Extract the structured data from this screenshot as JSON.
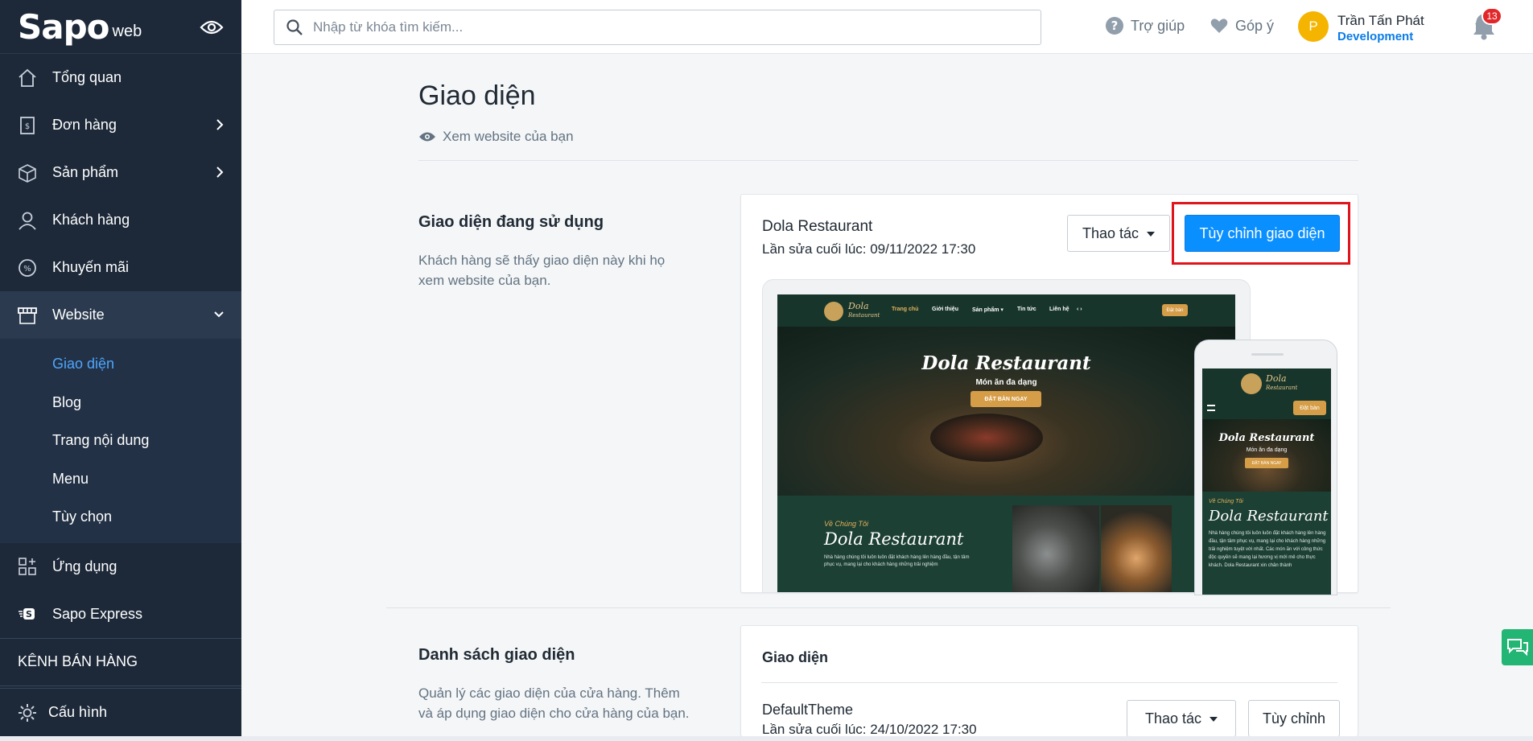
{
  "brand": {
    "logo_main": "Sapo",
    "logo_sub": "web"
  },
  "sidebar": {
    "items": [
      {
        "label": "Tổng quan",
        "icon": "home-icon"
      },
      {
        "label": "Đơn hàng",
        "icon": "order-icon"
      },
      {
        "label": "Sản phẩm",
        "icon": "box-icon"
      },
      {
        "label": "Khách hàng",
        "icon": "user-icon"
      },
      {
        "label": "Khuyến mãi",
        "icon": "discount-icon"
      },
      {
        "label": "Website",
        "icon": "store-icon"
      }
    ],
    "website_sub": [
      "Giao diện",
      "Blog",
      "Trang nội dung",
      "Menu",
      "Tùy chọn"
    ],
    "apps": {
      "label": "Ứng dụng",
      "icon": "apps-icon"
    },
    "express": {
      "label": "Sapo Express",
      "icon": "express-icon"
    },
    "channels_title": "KÊNH BÁN HÀNG",
    "config": {
      "label": "Cấu hình",
      "icon": "gear-icon"
    }
  },
  "topbar": {
    "search_placeholder": "Nhập từ khóa tìm kiếm...",
    "help": "Trợ giúp",
    "feedback": "Góp ý",
    "avatar_letter": "P",
    "user_name": "Trần Tấn Phát",
    "user_role": "Development",
    "notifications": "13"
  },
  "main": {
    "title": "Giao diện",
    "view_site": "Xem website của bạn",
    "current": {
      "section_title": "Giao diện đang sử dụng",
      "section_desc": "Khách hàng sẽ thấy giao diện này khi họ xem website của bạn.",
      "theme_name": "Dola Restaurant",
      "last_edit": "Lần sửa cuối lúc: 09/11/2022 17:30",
      "actions_btn": "Thao tác",
      "customize_btn": "Tùy chỉnh giao diện"
    },
    "preview": {
      "brand_line1": "Dola",
      "brand_line2": "Restaurant",
      "menu": [
        "Trang chủ",
        "Giới thiệu",
        "Sản phẩm ▾",
        "Tin tức",
        "Liên hệ",
        "‹ ›"
      ],
      "book": "Đặt bàn",
      "hero_title": "Dola Restaurant",
      "hero_sub": "Món ăn đa dạng",
      "hero_cta": "ĐẶT BÀN NGAY",
      "about_sub": "Về Chúng Tôi",
      "about_title": "Dola Restaurant",
      "about_text_desktop": "Nhà hàng chúng tôi luôn luôn đặt khách hàng lên hàng đầu, tận tâm phục vụ, mang lại cho khách hàng những trải nghiệm",
      "about_text_mobile": "Nhà hàng chúng tôi luôn luôn đặt khách hàng lên hàng đầu, tận tâm phục vụ, mang lại cho khách hàng những trải nghiệm tuyệt vời nhất. Các món ăn với công thức độc quyền sẽ mang lại hương vị mới mẻ cho thực khách. Dola Restaurant xin chân thành"
    },
    "list": {
      "section_title": "Danh sách giao diện",
      "section_desc": "Quản lý các giao diện của cửa hàng. Thêm và áp dụng giao diện cho cửa hàng của bạn.",
      "card_title": "Giao diện",
      "theme_name": "DefaultTheme",
      "last_edit": "Lần sửa cuối lúc: 24/10/2022 17:30",
      "actions_btn": "Thao tác",
      "customize_btn": "Tùy chỉnh"
    }
  },
  "colors": {
    "sidebar": "#1d2939",
    "accent": "#0a8fff",
    "highlight": "#e0141a",
    "active_sub": "#4ea6ff"
  }
}
